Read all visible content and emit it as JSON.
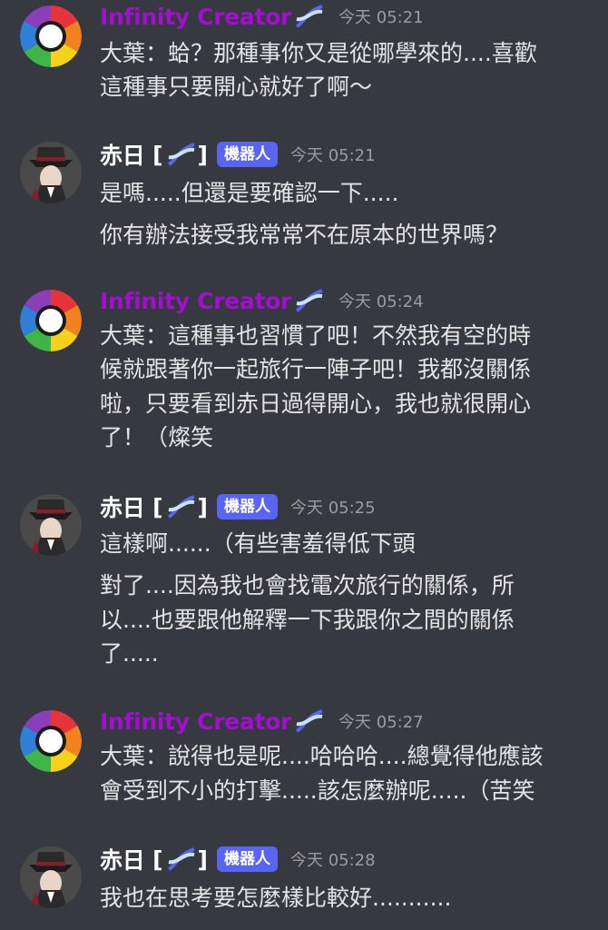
{
  "bot_tag": "機器人",
  "messages": [
    {
      "author": "Infinity Creator",
      "time": "今天 05:21",
      "lines": [
        "大葉：蛤？那種事你又是從哪學來的....喜歡",
        "這種事只要開心就好了啊～"
      ]
    },
    {
      "author": "赤日",
      "time": "今天 05:21",
      "lines": [
        "是嗎.....但還是要確認一下.....",
        "你有辦法接受我常常不在原本的世界嗎？"
      ]
    },
    {
      "author": "Infinity Creator",
      "time": "今天 05:24",
      "lines": [
        "大葉：這種事也習慣了吧！不然我有空的時",
        "候就跟著你一起旅行一陣子吧！我都沒關係",
        "啦，只要看到赤日過得開心，我也就很開心",
        "了！（燦笑"
      ]
    },
    {
      "author": "赤日",
      "time": "今天 05:25",
      "lines": [
        "這樣啊......（有些害羞得低下頭",
        "對了....因為我也會找電次旅行的關係，所",
        "以....也要跟他解釋一下我跟你之間的關係",
        "了....."
      ]
    },
    {
      "author": "Infinity Creator",
      "time": "今天 05:27",
      "lines": [
        "大葉：說得也是呢....哈哈哈....總覺得他應該",
        "會受到不小的打擊.....該怎麼辦呢.....（苦笑"
      ]
    },
    {
      "author": "赤日",
      "time": "今天 05:28",
      "lines": [
        "我也在思考要怎麼樣比較好..........."
      ]
    }
  ]
}
